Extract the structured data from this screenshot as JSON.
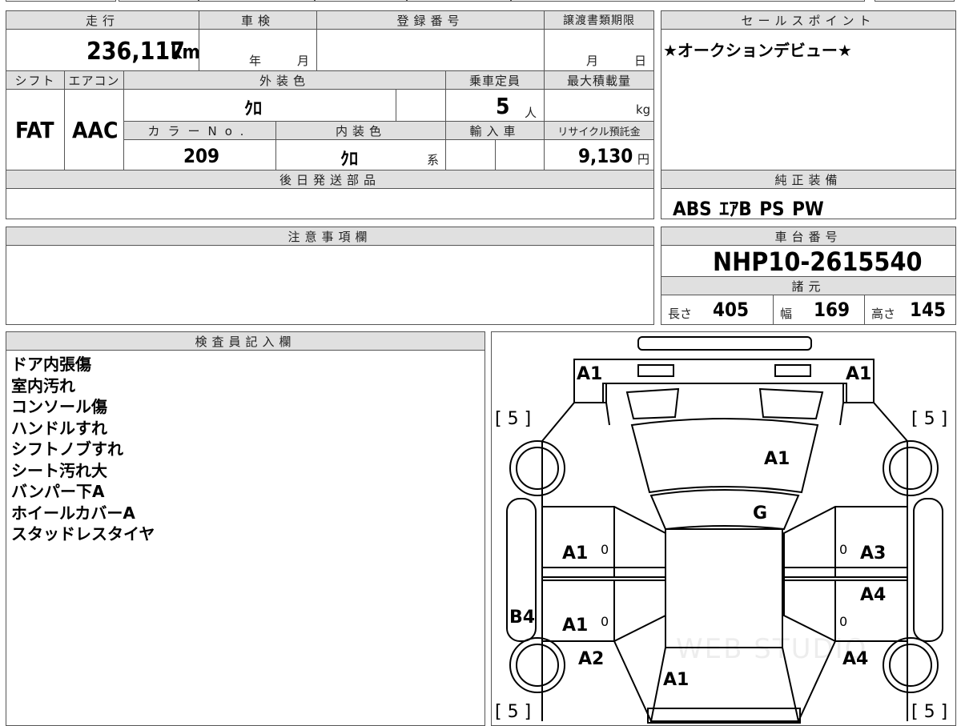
{
  "mileage": {
    "label": "走行",
    "value": "236,117",
    "unit": "km"
  },
  "shaken": {
    "label": "車検",
    "year_unit": "年",
    "month_unit": "月"
  },
  "registration": {
    "label": "登録番号"
  },
  "transfer_deadline": {
    "label": "譲渡書類期限",
    "month_unit": "月",
    "day_unit": "日"
  },
  "sales_point": {
    "label": "セールスポイント",
    "text": "★オークションデビュー★"
  },
  "shift": {
    "label": "シフト",
    "value": "FAT"
  },
  "aircon": {
    "label": "エアコン",
    "value": "AAC"
  },
  "exterior_color": {
    "label": "外装色",
    "value": "ｸﾛ"
  },
  "capacity": {
    "label": "乗車定員",
    "value": "5",
    "unit": "人"
  },
  "max_load": {
    "label": "最大積載量",
    "unit": "kg"
  },
  "color_no": {
    "label": "カラーNo.",
    "value": "209"
  },
  "interior_color": {
    "label": "内装色",
    "value": "ｸﾛ",
    "unit": "系"
  },
  "import": {
    "label": "輸入車"
  },
  "recycle": {
    "label": "リサイクル預託金",
    "value": "9,130",
    "unit": "円"
  },
  "later_parts": {
    "label": "後日発送部品"
  },
  "genuine_equipment": {
    "label": "純正装備",
    "value": "ABS ｴｱB PS PW"
  },
  "caution": {
    "label": "注意事項欄"
  },
  "chassis": {
    "label": "車台番号",
    "value": "NHP10-2615540"
  },
  "specs": {
    "label": "諸元",
    "length_label": "長さ",
    "length": "405",
    "width_label": "幅",
    "width": "169",
    "height_label": "高さ",
    "height": "145"
  },
  "inspector": {
    "label": "検査員記入欄",
    "notes": [
      "ドア内張傷",
      "室内汚れ",
      "コンソール傷",
      "ハンドルすれ",
      "シフトノブすれ",
      "シート汚れ大",
      "バンパー下A",
      "ホイールカバーA",
      "スタッドレスタイヤ"
    ]
  },
  "diagram": {
    "grade_a1_l": "A1",
    "grade_a1_r": "A1",
    "tire_fl": "[ 5 ]",
    "tire_fr": "[ 5 ]",
    "tire_rl": "[ 5 ]",
    "tire_rr": "[ 5 ]",
    "hood": "A1",
    "windshield": "G",
    "front_door_l": "A1",
    "front_door_r": "A3",
    "rear_door_r": "A4",
    "rear_door_l": "A1",
    "sill_l": "B4",
    "quarter_l": "A2",
    "quarter_r": "A4",
    "rear": "A1",
    "mark_fl": "0",
    "mark_fr": "0",
    "mark_rl": "0",
    "mark_rr": "0",
    "watermark": "WEB STUDIO"
  }
}
